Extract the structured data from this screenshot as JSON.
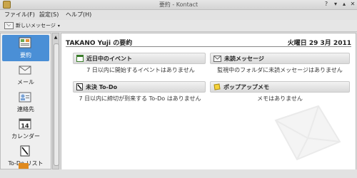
{
  "window": {
    "title": "要約 - Kontact"
  },
  "menu": {
    "items": [
      "ファイル(F)",
      "設定(S)",
      "ヘルプ(H)"
    ]
  },
  "toolbar": {
    "new_message": "新しいメッセージ"
  },
  "sidebar": {
    "items": [
      {
        "label": "要約",
        "icon": "summary-icon",
        "active": true
      },
      {
        "label": "メール",
        "icon": "mail-icon"
      },
      {
        "label": "連絡先",
        "icon": "contacts-icon"
      },
      {
        "label": "カレンダー",
        "icon": "calendar-icon",
        "calendar_day": "14"
      },
      {
        "label": "To-Do リスト",
        "icon": "todo-icon"
      }
    ]
  },
  "summary": {
    "title": "TAKANO Yuji の要約",
    "date": "火曜日 29 3月 2011",
    "sections": [
      {
        "title": "近日中のイベント",
        "text": "7 日以内に開始するイベントはありません"
      },
      {
        "title": "未読メッセージ",
        "text": "監視中のフォルダに未読メッセージはありません"
      },
      {
        "title": "未決 To-Do",
        "text": "7 日以内に締切が到来する To-Do はありません"
      },
      {
        "title": "ポップアップメモ",
        "text": "メモはありません"
      }
    ]
  },
  "colors": {
    "accent": "#4a8fd6"
  }
}
